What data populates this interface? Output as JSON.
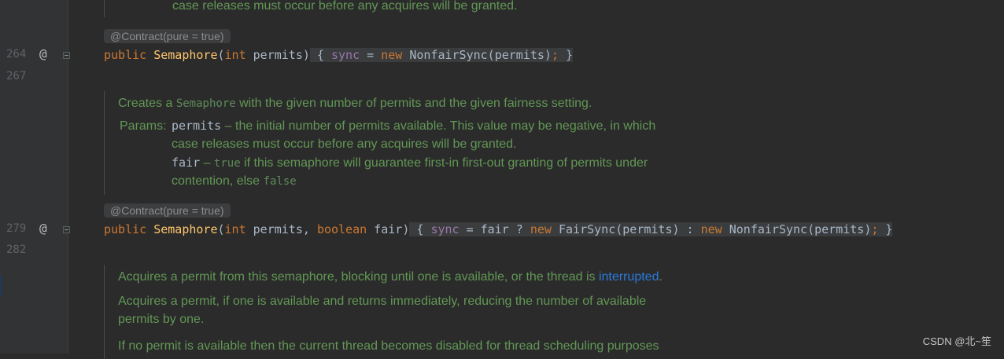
{
  "editor": {
    "line_numbers": [
      "264",
      "267",
      "279",
      "282"
    ],
    "gutter_marks": [
      "@",
      "@"
    ],
    "doc0": {
      "line": "case releases must occur before any acquires will be granted."
    },
    "anno_label": "@Contract(pure = true)",
    "ctor1": {
      "public": "public",
      "name": "Semaphore",
      "open": "(",
      "int": "int",
      "param": " permits",
      "close": ")",
      "body_open": " { ",
      "sync": "sync",
      "eq": " = ",
      "new": "new",
      "call": " NonfairSync(permits)",
      "semi": ";",
      "body_close": " }"
    },
    "doc1": {
      "desc_pre": "Creates a ",
      "desc_code": "Semaphore",
      "desc_post": " with the given number of permits and the given fairness setting.",
      "params_label": "Params:",
      "p1_name": "permits",
      "p1_text": " – the initial number of permits available. This value may be negative, in which",
      "p1_cont": "case releases must occur before any acquires will be granted.",
      "p2_name": "fair",
      "p2_pre": " – ",
      "p2_code": "true",
      "p2_text": " if this semaphore will guarantee first-in first-out granting of permits under",
      "p2_cont_pre": "contention, else ",
      "p2_cont_code": "false"
    },
    "ctor2": {
      "public": "public",
      "name": "Semaphore",
      "open": "(",
      "int": "int",
      "param1": " permits, ",
      "boolean": "boolean",
      "param2": " fair",
      "close": ")",
      "body_open": " { ",
      "sync": "sync",
      "eq": " = fair ? ",
      "new1": "new",
      "call1": " FairSync(permits) : ",
      "new2": "new",
      "call2": " NonfairSync(permits)",
      "semi": ";",
      "body_close": " }"
    },
    "doc2": {
      "l1_pre": "Acquires a permit from this semaphore, blocking until one is available, or the thread is ",
      "l1_link": "interrupted",
      "l1_post": ".",
      "l2": "Acquires a permit, if one is available and returns immediately, reducing the number of available",
      "l3": "permits by one.",
      "l4": "If no permit is available then the current thread becomes disabled for thread scheduling purposes"
    }
  },
  "watermark": "CSDN @北~笙"
}
